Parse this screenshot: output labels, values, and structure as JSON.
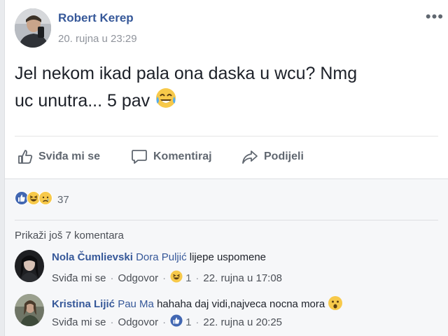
{
  "post": {
    "author": "Robert Kerep",
    "timestamp": "20. rujna u 23:29",
    "more_menu": "•••",
    "text_line1": "Jel nekom ikad pala ona daska u wcu? Nmg",
    "text_line2": "uc unutra... 5 pav",
    "text_emoji": "tears-of-joy-emoji"
  },
  "actions": {
    "like_label": "Sviđa mi se",
    "comment_label": "Komentiraj",
    "share_label": "Podijeli"
  },
  "reactions": {
    "types": [
      "like-reaction-icon",
      "haha-reaction-icon",
      "sad-reaction-icon"
    ],
    "count": "37"
  },
  "comments_section": {
    "more_comments_label": "Prikaži još 7 komentara",
    "comments": [
      {
        "author": "Nola Čumlievski",
        "tag": "Dora Puljić",
        "text": "lijepe uspomene",
        "like_label": "Sviđa mi se",
        "reply_label": "Odgovor",
        "reaction_icon": "haha-reaction-icon",
        "reaction_count": "1",
        "timestamp": "22. rujna u 17:08",
        "sep": "·"
      },
      {
        "author": "Kristina Lijić",
        "tag": "Pau Ma",
        "text": "hahaha daj vidi,najveca nocna mora",
        "text_emoji": "surprised-face-emoji",
        "like_label": "Sviđa mi se",
        "reply_label": "Odgovor",
        "reaction_icon": "like-reaction-icon",
        "reaction_count": "1",
        "timestamp": "22. rujna u 20:25",
        "sep": "·"
      }
    ]
  },
  "colors": {
    "link_blue": "#365899",
    "like_blue": "#4267b2",
    "emoji_yellow": "#f7c94a",
    "muted": "#90949c"
  }
}
